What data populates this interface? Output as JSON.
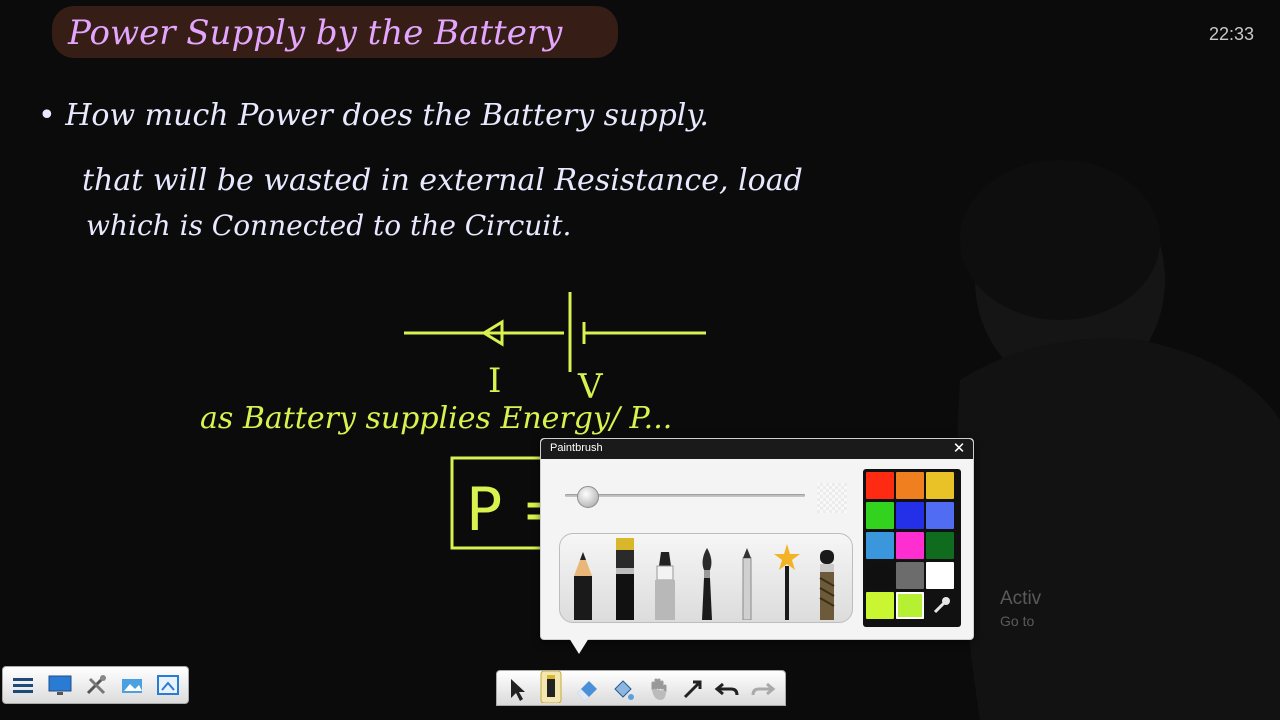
{
  "clock": "22:33",
  "watermark": {
    "line1": "Activ",
    "line2": "Go to"
  },
  "board": {
    "title": "Power Supply by the Battery",
    "lines": [
      "• How much Power does the Battery supply.",
      "that will be wasted in external Resistance, load",
      "which is Connected to the Circuit."
    ],
    "circuit_labels": {
      "current": "I",
      "voltage": "V"
    },
    "note": "as Battery supplies Energy/ P...",
    "formula": "P ="
  },
  "paintbrush": {
    "title": "Paintbrush",
    "close_icon": "close-icon",
    "size_level": 0.05,
    "brushes": [
      "pencil",
      "brush-marker",
      "highlighter",
      "calligraphy-brush",
      "pen",
      "magic-star-wand",
      "texture-brush"
    ],
    "selected_brush": "brush-marker",
    "colors": [
      "#ff2a12",
      "#f07f20",
      "#e8c226",
      "#32d21f",
      "#2330e8",
      "#4f6cf2",
      "#3a97dc",
      "#ff2ed0",
      "#0f6b1d",
      "#101010",
      "#6c6c6c",
      "#ffffff",
      "#c9f531",
      "#b6f033"
    ],
    "selected_color": "#b6f033",
    "eyedropper_icon": "eyedropper-icon"
  },
  "left_toolbar": [
    "menu-icon",
    "monitor-icon",
    "tools-icon",
    "gallery-icon",
    "screenshot-icon"
  ],
  "center_toolbar": [
    "select-arrow-icon",
    "pen-tool-icon",
    "eraser-icon",
    "fill-icon",
    "hand-icon",
    "shapes-arrow-icon",
    "undo-icon",
    "redo-icon"
  ]
}
